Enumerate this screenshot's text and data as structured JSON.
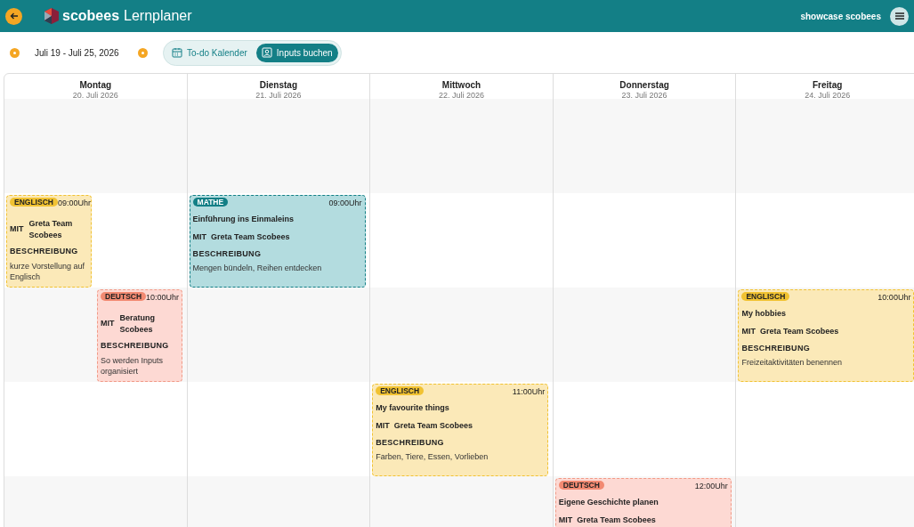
{
  "header": {
    "app_name": "scobees",
    "app_subtitle": "Lernplaner",
    "user": "showcase scobees"
  },
  "toolbar": {
    "date_range": "Juli 19 - Juli 25, 2026",
    "tabs": [
      {
        "label": "To-do Kalender",
        "selected": false
      },
      {
        "label": "Inputs buchen",
        "selected": true
      }
    ]
  },
  "calendar": {
    "days": [
      {
        "name": "Montag",
        "date": "20. Juli 2026",
        "events": [
          {
            "kind": "englisch",
            "subject": "ENGLISCH",
            "time": "09:00Uhr",
            "with_label": "MIT",
            "teacher": "Greta Team Scobees",
            "description_label": "BESCHREIBUNG",
            "description": "kurze Vorstellung auf Englisch"
          },
          {
            "kind": "deutsch",
            "subject": "DEUTSCH",
            "time": "10:00Uhr",
            "with_label": "MIT",
            "teacher": "Beratung Scobees",
            "description_label": "BESCHREIBUNG",
            "description": "So werden Inputs organisiert"
          }
        ]
      },
      {
        "name": "Dienstag",
        "date": "21. Juli 2026",
        "events": [
          {
            "kind": "mathe",
            "subject": "MATHE",
            "time": "09:00Uhr",
            "title": "Einführung ins Einmaleins",
            "with_label": "MIT",
            "teacher": "Greta Team Scobees",
            "description_label": "BESCHREIBUNG",
            "description": "Mengen bündeln, Reihen entdecken"
          }
        ]
      },
      {
        "name": "Mittwoch",
        "date": "22. Juli 2026",
        "events": [
          {
            "kind": "englisch",
            "subject": "ENGLISCH",
            "time": "11:00Uhr",
            "title": "My favourite things",
            "with_label": "MIT",
            "teacher": "Greta Team Scobees",
            "description_label": "BESCHREIBUNG",
            "description": "Farben, Tiere, Essen, Vorlieben"
          }
        ]
      },
      {
        "name": "Donnerstag",
        "date": "23. Juli 2026",
        "events": [
          {
            "kind": "deutsch",
            "subject": "DEUTSCH",
            "time": "12:00Uhr",
            "title": "Eigene Geschichte planen",
            "with_label": "MIT",
            "teacher": "Greta Team Scobees"
          }
        ]
      },
      {
        "name": "Freitag",
        "date": "24. Juli 2026",
        "events": [
          {
            "kind": "englisch",
            "subject": "ENGLISCH",
            "time": "10:00Uhr",
            "title": "My hobbies",
            "with_label": "MIT",
            "teacher": "Greta Team Scobees",
            "description_label": "BESCHREIBUNG",
            "description": "Freizeitaktivitäten benennen"
          }
        ]
      }
    ]
  }
}
